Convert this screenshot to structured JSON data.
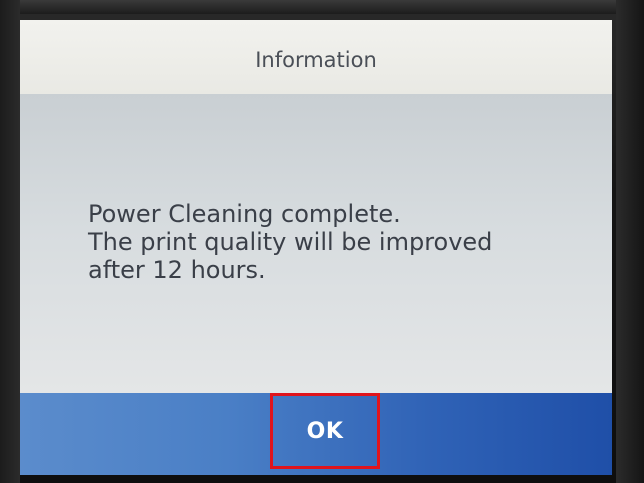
{
  "dialog": {
    "title": "Information",
    "message_lines": [
      "Power Cleaning complete.",
      "The print quality will be improved",
      "after 12 hours."
    ],
    "ok_label": "OK"
  },
  "colors": {
    "header_bg": "#efefea",
    "body_bg": "#d7dcdf",
    "footer_bg": "#3a6fbd",
    "highlight_border": "#e0141c",
    "text": "#3a3f48"
  }
}
